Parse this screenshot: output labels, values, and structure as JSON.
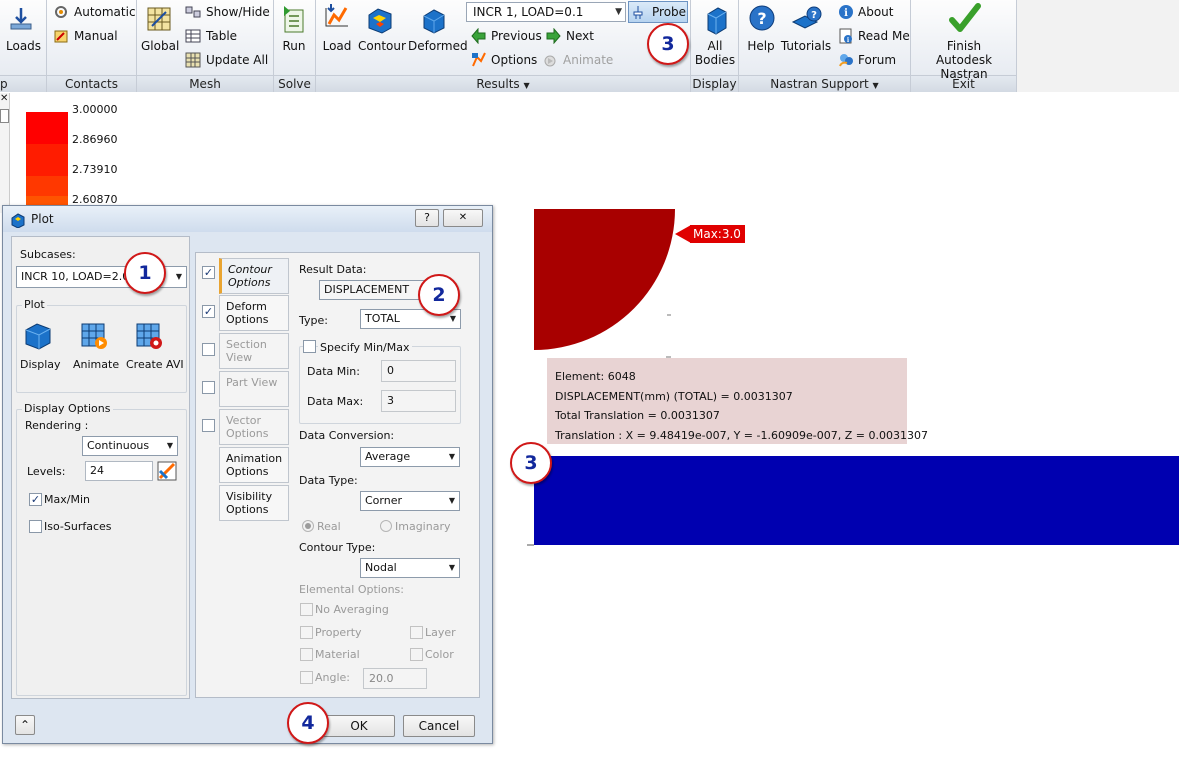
{
  "ribbon": {
    "groups": [
      {
        "label": "p"
      },
      {
        "label": "Contacts"
      },
      {
        "label": "Mesh"
      },
      {
        "label": "Solve"
      },
      {
        "label": "Results"
      },
      {
        "label": "Display"
      },
      {
        "label": "Nastran Support"
      },
      {
        "label": "Exit"
      }
    ],
    "results_dropdown_glyph": "▼",
    "support_dropdown_glyph": "▼",
    "loads_label": "Loads",
    "automatic_label": "Automatic",
    "manual_label": "Manual",
    "global_label": "Global",
    "show_hide_label": "Show/Hide",
    "table_label": "Table",
    "update_all_label": "Update  All",
    "run_label": "Run",
    "load_label": "Load",
    "contour_label": "Contour",
    "deformed_label": "Deformed",
    "subcase_select": "INCR 1, LOAD=0.1",
    "probe_label": "Probe",
    "previous_label": "Previous",
    "next_label": "Next",
    "options_label": "Options",
    "animate_label": "Animate",
    "all_bodies_line1": "All",
    "all_bodies_line2": "Bodies",
    "help_label": "Help",
    "tutorials_label": "Tutorials",
    "about_label": "About",
    "read_me_label": "Read Me",
    "forum_label": "Forum",
    "finish_line1": "Finish",
    "finish_line2": "Autodesk Nastran"
  },
  "legend": {
    "values": [
      "3.00000",
      "2.86960",
      "2.73910",
      "2.60870"
    ],
    "colors": [
      "#ff0000",
      "#ff1c00",
      "#ff3800",
      "#ff5400"
    ]
  },
  "dialog": {
    "title": "Plot",
    "help_btn": "?",
    "close_btn": "✕",
    "subcases_label": "Subcases:",
    "subcase_value": "INCR 10, LOAD=2.0",
    "plot_section": "Plot",
    "display_btn": "Display",
    "animate_btn": "Animate",
    "create_avi_btn": "Create AVI",
    "display_options_section": "Display Options",
    "rendering_label": "Rendering :",
    "rendering_value": "Continuous",
    "levels_label": "Levels:",
    "levels_value": "24",
    "max_min_label": "Max/Min",
    "iso_surfaces_label": "Iso-Surfaces",
    "tabs": [
      {
        "label": "Contour Options"
      },
      {
        "label": "Deform Options"
      },
      {
        "label": "Section View"
      },
      {
        "label": "Part View"
      },
      {
        "label": "Vector Options"
      },
      {
        "label": "Animation Options"
      },
      {
        "label": "Visibility Options"
      }
    ],
    "result_data_label": "Result Data:",
    "result_data_value": "DISPLACEMENT",
    "type_label": "Type:",
    "type_value": "TOTAL",
    "specify_minmax_label": "Specify Min/Max",
    "data_min_label": "Data Min:",
    "data_min_value": "0",
    "data_max_label": "Data Max:",
    "data_max_value": "3",
    "data_conversion_label": "Data Conversion:",
    "data_conversion_value": "Average",
    "data_type_label": "Data Type:",
    "data_type_value": "Corner",
    "real_label": "Real",
    "imaginary_label": "Imaginary",
    "contour_type_label": "Contour Type:",
    "contour_type_value": "Nodal",
    "elemental_options_label": "Elemental Options:",
    "no_averaging_label": "No Averaging",
    "property_label": "Property",
    "layer_label": "Layer",
    "material_label": "Material",
    "color_label": "Color",
    "angle_label": "Angle:",
    "angle_value": "20.0",
    "ok_btn": "OK",
    "cancel_btn": "Cancel",
    "collapse_glyph": "⌃"
  },
  "model": {
    "max_label": "Max:3.0",
    "probe_info": [
      "Element: 6048",
      "DISPLACEMENT(mm) (TOTAL) = 0.0031307",
      "Total Translation        = 0.0031307",
      "Translation : X         = 9.48419e-007, Y = -1.60909e-007, Z = 0.0031307"
    ]
  },
  "callouts": [
    "1",
    "2",
    "3",
    "3",
    "4"
  ],
  "colors": {
    "accent_red": "#a80000",
    "deformed_blue": "#0000b0",
    "callout_red": "#d01818",
    "callout_text": "#12289c"
  },
  "checkbox_mark": "✓"
}
